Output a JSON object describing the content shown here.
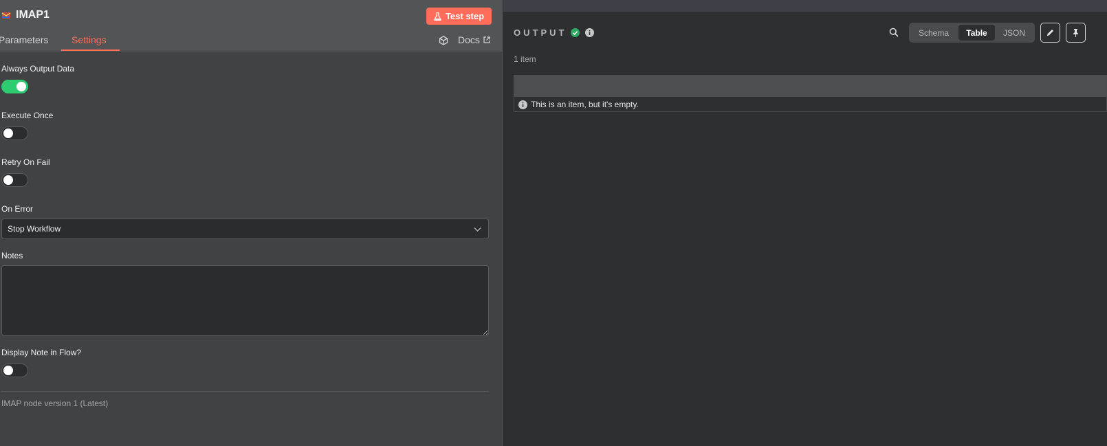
{
  "node": {
    "title": "IMAP1",
    "test_button": "Test step"
  },
  "tabs": [
    {
      "label": "Parameters"
    },
    {
      "label": "Settings"
    }
  ],
  "docs": {
    "label": "Docs"
  },
  "settings": {
    "always_output": {
      "label": "Always Output Data",
      "enabled": true
    },
    "execute_once": {
      "label": "Execute Once",
      "enabled": false
    },
    "retry_on_fail": {
      "label": "Retry On Fail",
      "enabled": false
    },
    "on_error": {
      "label": "On Error",
      "value": "Stop Workflow"
    },
    "notes": {
      "label": "Notes",
      "value": ""
    },
    "display_note": {
      "label": "Display Note in Flow?",
      "enabled": false
    },
    "version": "IMAP node version 1 (Latest)"
  },
  "output": {
    "title": "OUTPUT",
    "count": "1 item",
    "views": [
      "Schema",
      "Table",
      "JSON"
    ],
    "selected_view": "Table",
    "empty_message": "This is an item, but it's empty."
  },
  "colors": {
    "accent": "#ff6d5a",
    "toggle_on": "#2ecc71",
    "success": "#2ea963"
  },
  "icons": {
    "test": "flask-icon",
    "docs": "cube-icon",
    "external": "external-link-icon",
    "edit": "pencil-icon",
    "pin": "pin-icon"
  }
}
